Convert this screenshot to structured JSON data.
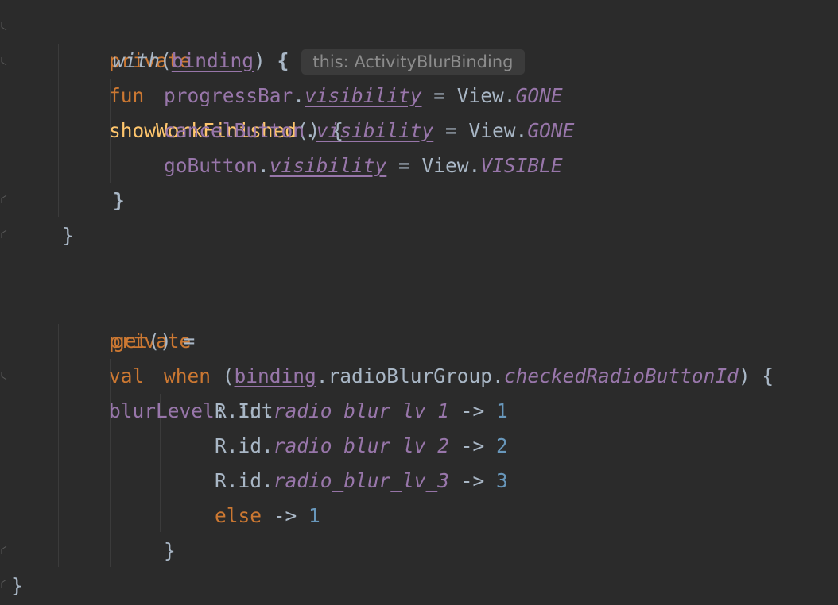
{
  "code": {
    "l1": {
      "kw1": "private",
      "kw2": "fun",
      "fn": "showWorkFinished",
      "rest": "() {"
    },
    "l2": {
      "with": "with",
      "open": "(",
      "binding": "binding",
      "close": ")",
      "brace": "{",
      "hint": "this: ActivityBlurBinding"
    },
    "l3": {
      "obj": "progressBar",
      "dot": ".",
      "prop": "visibility",
      "eq": " = View.",
      "val": "GONE"
    },
    "l4": {
      "obj": "cancelButton",
      "dot": ".",
      "prop": "visibility",
      "eq": " = View.",
      "val": "GONE"
    },
    "l5": {
      "obj": "goButton",
      "dot": ".",
      "prop": "visibility",
      "eq": " = View.",
      "val": "VISIBLE"
    },
    "l6": {
      "text": "}"
    },
    "l7": {
      "text": "}"
    },
    "l8": {
      "kw1": "private",
      "kw2": "val",
      "name": "blurLevel",
      "colon": ": ",
      "type": "Int"
    },
    "l9": {
      "kw": "get",
      "rest": "() ="
    },
    "l10": {
      "kw": "when",
      "open": " (",
      "binding": "binding",
      "mid": ".radioBlurGroup.",
      "prop": "checkedRadioButtonId",
      "close": ") {"
    },
    "l11": {
      "prefix": "R.id.",
      "id": "radio_blur_lv_1",
      "arrow": " -> ",
      "num": "1"
    },
    "l12": {
      "prefix": "R.id.",
      "id": "radio_blur_lv_2",
      "arrow": " -> ",
      "num": "2"
    },
    "l13": {
      "prefix": "R.id.",
      "id": "radio_blur_lv_3",
      "arrow": " -> ",
      "num": "3"
    },
    "l14": {
      "kw": "else",
      "arrow": " -> ",
      "num": "1"
    },
    "l15": {
      "text": "}"
    },
    "l16": {
      "text": "}"
    }
  },
  "colors": {
    "background": "#2b2b2b",
    "keyword": "#cc7832",
    "function": "#ffc66d",
    "property": "#9876aa",
    "number": "#6897bb",
    "text": "#a9b7c6",
    "hint_bg": "#3b3b3b",
    "hint_text": "#8c8c8c"
  }
}
